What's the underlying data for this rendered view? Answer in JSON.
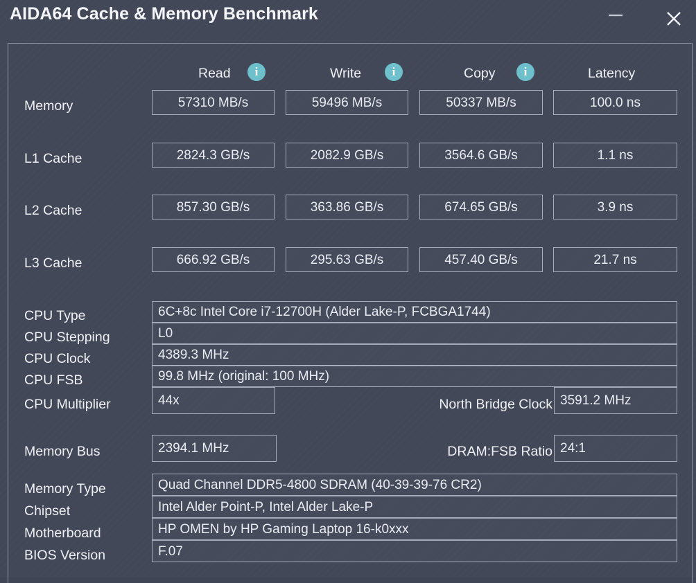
{
  "window": {
    "title": "AIDA64 Cache & Memory Benchmark",
    "minimize_label": "–",
    "close_label": "×"
  },
  "benchmark": {
    "columns": [
      {
        "label": "Read",
        "has_info": true
      },
      {
        "label": "Write",
        "has_info": true
      },
      {
        "label": "Copy",
        "has_info": true
      },
      {
        "label": "Latency",
        "has_info": false
      }
    ],
    "rows": [
      {
        "label": "Memory",
        "read": "57310 MB/s",
        "write": "59496 MB/s",
        "copy": "50337 MB/s",
        "latency": "100.0 ns"
      },
      {
        "label": "L1 Cache",
        "read": "2824.3 GB/s",
        "write": "2082.9 GB/s",
        "copy": "3564.6 GB/s",
        "latency": "1.1 ns"
      },
      {
        "label": "L2 Cache",
        "read": "857.30 GB/s",
        "write": "363.86 GB/s",
        "copy": "674.65 GB/s",
        "latency": "3.9 ns"
      },
      {
        "label": "L3 Cache",
        "read": "666.92 GB/s",
        "write": "295.63 GB/s",
        "copy": "457.40 GB/s",
        "latency": "21.7 ns"
      }
    ]
  },
  "cpu_info": {
    "cpu_type_label": "CPU Type",
    "cpu_type_value": "6C+8c Intel Core i7-12700H  (Alder Lake-P, FCBGA1744)",
    "cpu_stepping_label": "CPU Stepping",
    "cpu_stepping_value": "L0",
    "cpu_clock_label": "CPU Clock",
    "cpu_clock_value": "4389.3 MHz",
    "cpu_fsb_label": "CPU FSB",
    "cpu_fsb_value": "99.8 MHz  (original: 100 MHz)",
    "cpu_multiplier_label": "CPU Multiplier",
    "cpu_multiplier_value": "44x",
    "north_bridge_clock_label": "North Bridge Clock",
    "north_bridge_clock_value": "3591.2 MHz"
  },
  "memory_info": {
    "memory_bus_label": "Memory Bus",
    "memory_bus_value": "2394.1 MHz",
    "dram_fsb_ratio_label": "DRAM:FSB Ratio",
    "dram_fsb_ratio_value": "24:1",
    "memory_type_label": "Memory Type",
    "memory_type_value": "Quad Channel DDR5-4800 SDRAM  (40-39-39-76 CR2)",
    "chipset_label": "Chipset",
    "chipset_value": "Intel Alder Point-P, Intel Alder Lake-P",
    "motherboard_label": "Motherboard",
    "motherboard_value": "HP OMEN by HP Gaming Laptop 16-k0xxx",
    "bios_version_label": "BIOS Version",
    "bios_version_value": "F.07"
  },
  "colors": {
    "background": "#424857",
    "text": "#e9ecf2",
    "border": "#a6acba",
    "info_icon": "#6fc0cd"
  }
}
